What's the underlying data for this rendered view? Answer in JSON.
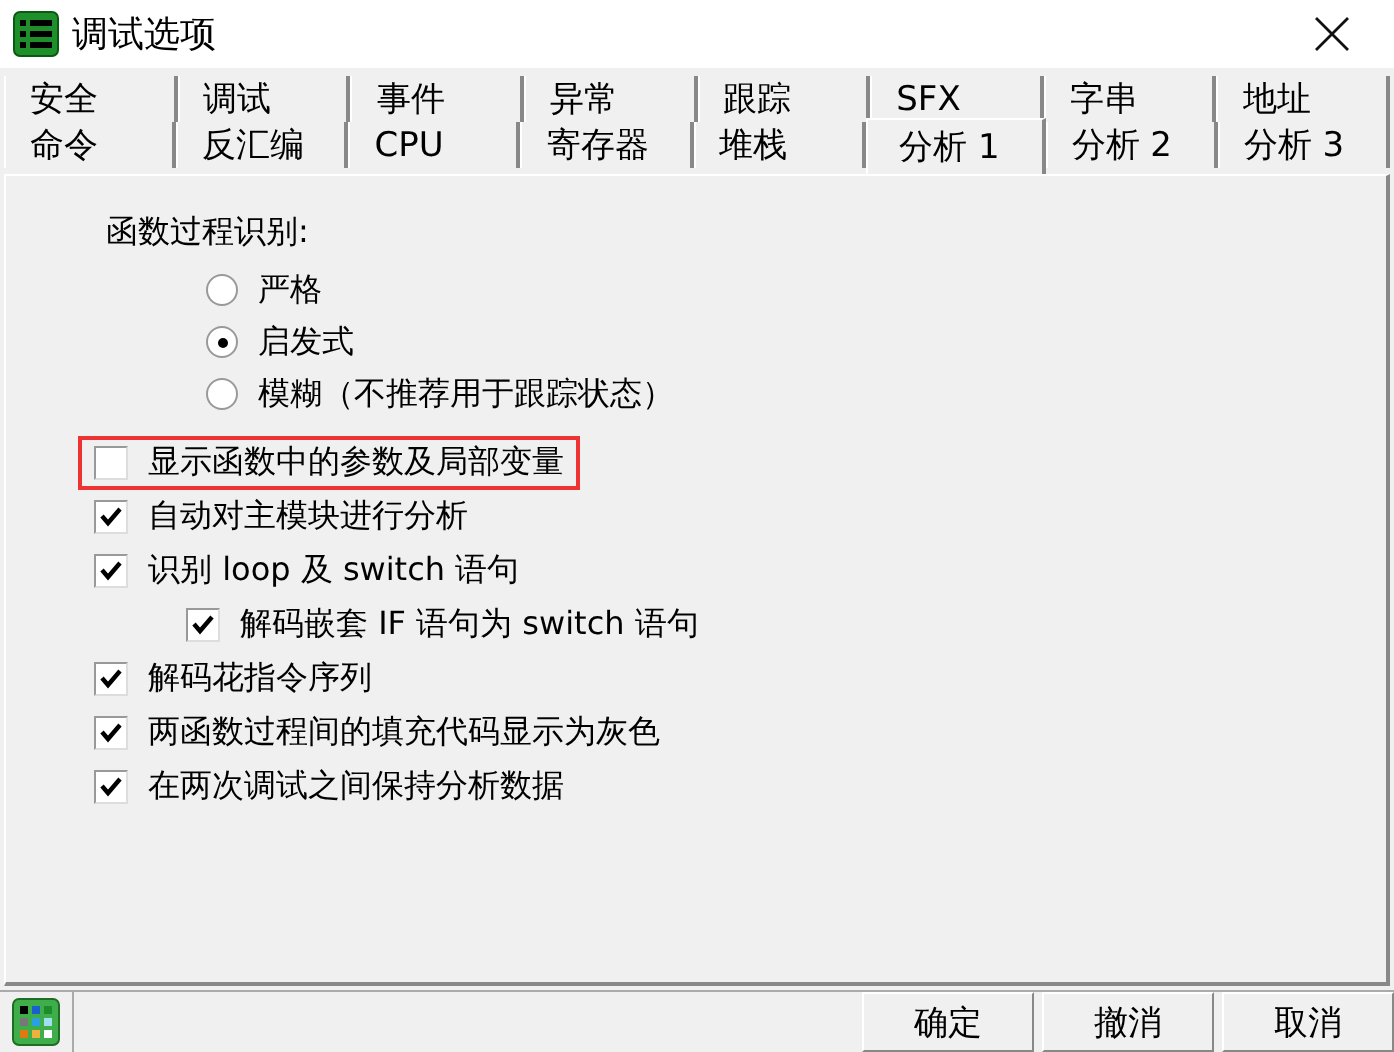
{
  "window": {
    "title": "调试选项"
  },
  "tab_rows": [
    [
      {
        "label": "安全",
        "selected": false
      },
      {
        "label": "调试",
        "selected": false
      },
      {
        "label": "事件",
        "selected": false
      },
      {
        "label": "异常",
        "selected": false
      },
      {
        "label": "跟踪",
        "selected": false
      },
      {
        "label": "SFX",
        "selected": false
      },
      {
        "label": "字串",
        "selected": false
      },
      {
        "label": "地址",
        "selected": false
      }
    ],
    [
      {
        "label": "命令",
        "selected": false
      },
      {
        "label": "反汇编",
        "selected": false
      },
      {
        "label": "CPU",
        "selected": false
      },
      {
        "label": "寄存器",
        "selected": false
      },
      {
        "label": "堆栈",
        "selected": false
      },
      {
        "label": "分析 1",
        "selected": true
      },
      {
        "label": "分析 2",
        "selected": false
      },
      {
        "label": "分析 3",
        "selected": false
      }
    ]
  ],
  "radio_group": {
    "label": "函数过程识别:",
    "options": [
      {
        "label": "严格",
        "selected": false
      },
      {
        "label": "启发式",
        "selected": true
      },
      {
        "label": "模糊（不推荐用于跟踪状态）",
        "selected": false
      }
    ]
  },
  "checkboxes": [
    {
      "label": "显示函数中的参数及局部变量",
      "checked": false,
      "highlighted": true
    },
    {
      "label": "自动对主模块进行分析",
      "checked": true,
      "highlighted": false
    },
    {
      "label": "识别 loop 及 switch 语句",
      "checked": true,
      "highlighted": false,
      "children": [
        {
          "label": "解码嵌套 IF 语句为 switch 语句",
          "checked": true,
          "highlighted": false
        }
      ]
    },
    {
      "label": "解码花指令序列",
      "checked": true,
      "highlighted": false
    },
    {
      "label": "两函数过程间的填充代码显示为灰色",
      "checked": true,
      "highlighted": false
    },
    {
      "label": "在两次调试之间保持分析数据",
      "checked": true,
      "highlighted": false
    }
  ],
  "buttons": [
    "确定",
    "撤消",
    "取消"
  ]
}
